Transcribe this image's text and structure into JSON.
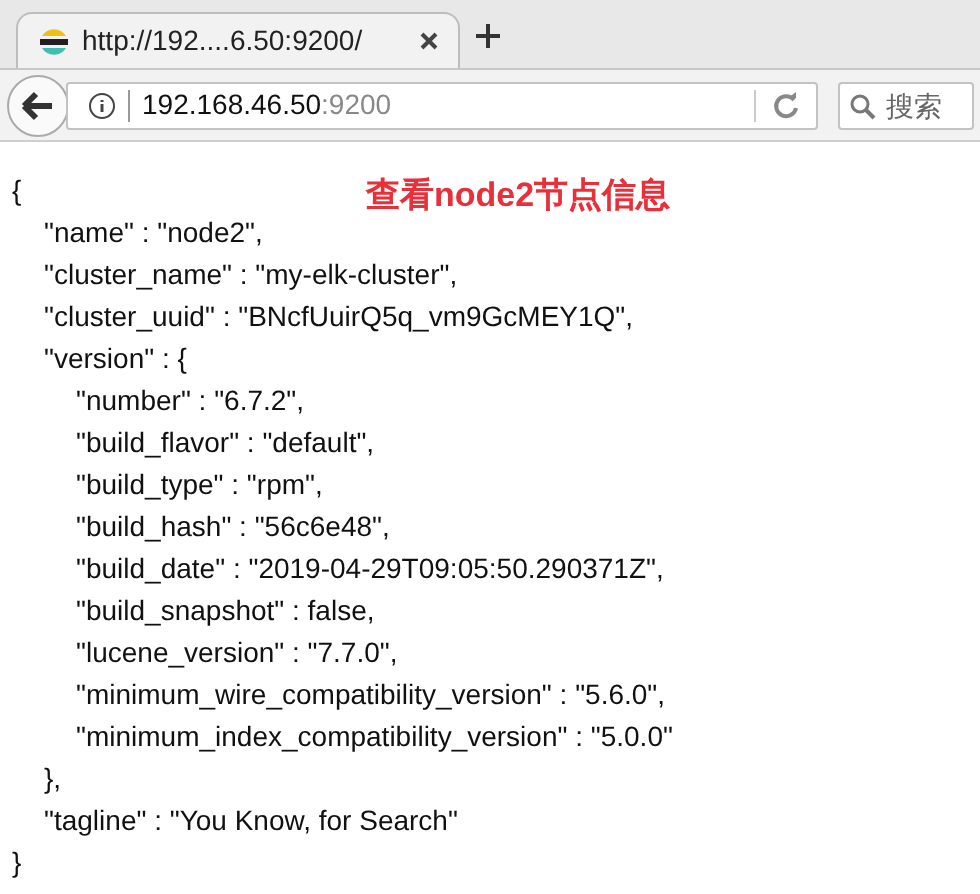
{
  "tabs": [
    {
      "title": "http://192....6.50:9200/",
      "selected": true
    }
  ],
  "address_bar": {
    "host": "192.168.46.50",
    "port": ":9200"
  },
  "search": {
    "placeholder": "搜索"
  },
  "annotation": "查看node2节点信息",
  "json_lines": [
    {
      "text": "{",
      "children": [
        {
          "text": "\"name\" : \"node2\","
        },
        {
          "text": "\"cluster_name\" : \"my-elk-cluster\","
        },
        {
          "text": "\"cluster_uuid\" : \"BNcfUuirQ5q_vm9GcMEY1Q\","
        },
        {
          "text": "\"version\" : {",
          "children": [
            {
              "text": "\"number\" : \"6.7.2\","
            },
            {
              "text": "\"build_flavor\" : \"default\","
            },
            {
              "text": "\"build_type\" : \"rpm\","
            },
            {
              "text": "\"build_hash\" : \"56c6e48\","
            },
            {
              "text": "\"build_date\" : \"2019-04-29T09:05:50.290371Z\","
            },
            {
              "text": "\"build_snapshot\" : false,"
            },
            {
              "text": "\"lucene_version\" : \"7.7.0\","
            },
            {
              "text": "\"minimum_wire_compatibility_version\" : \"5.6.0\","
            },
            {
              "text": "\"minimum_index_compatibility_version\" : \"5.0.0\""
            }
          ]
        },
        {
          "text": "},"
        },
        {
          "text": "\"tagline\" : \"You Know, for Search\""
        }
      ]
    },
    {
      "text": "}"
    }
  ]
}
